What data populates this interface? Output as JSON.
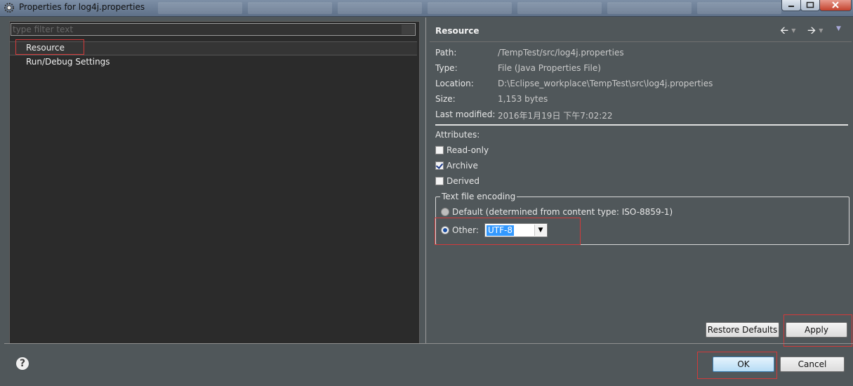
{
  "window": {
    "title": "Properties for log4j.properties"
  },
  "filter": {
    "placeholder": "type filter text"
  },
  "tree": {
    "items": [
      {
        "label": "Resource",
        "selected": true
      },
      {
        "label": "Run/Debug Settings",
        "selected": false
      }
    ]
  },
  "page": {
    "title": "Resource"
  },
  "info": {
    "path": {
      "label": "Path:",
      "value": "/TempTest/src/log4j.properties"
    },
    "type": {
      "label": "Type:",
      "value": "File  (Java Properties File)"
    },
    "location": {
      "label": "Location:",
      "value": "D:\\Eclipse_workplace\\TempTest\\src\\log4j.properties"
    },
    "size": {
      "label": "Size:",
      "value": "1,153  bytes"
    },
    "modified": {
      "label": "Last modified:",
      "value": "2016年1月19日 下午7:02:22"
    }
  },
  "attributes": {
    "heading": "Attributes:",
    "read_only": {
      "label": "Read-only",
      "checked": false
    },
    "archive": {
      "label": "Archive",
      "checked": true
    },
    "derived": {
      "label": "Derived",
      "checked": false
    }
  },
  "encoding": {
    "legend": "Text file encoding",
    "default_label": "Default (determined from content type: ISO-8859-1)",
    "other_label": "Other:",
    "selected": "other",
    "other_value": "UTF-8"
  },
  "buttons": {
    "restore_defaults": "Restore Defaults",
    "apply": "Apply",
    "ok": "OK",
    "cancel": "Cancel"
  },
  "colors": {
    "background": "#50575a",
    "tree_background": "#2b2b2b",
    "highlight": "#d23a3a",
    "selection_blue": "#3399ff"
  }
}
